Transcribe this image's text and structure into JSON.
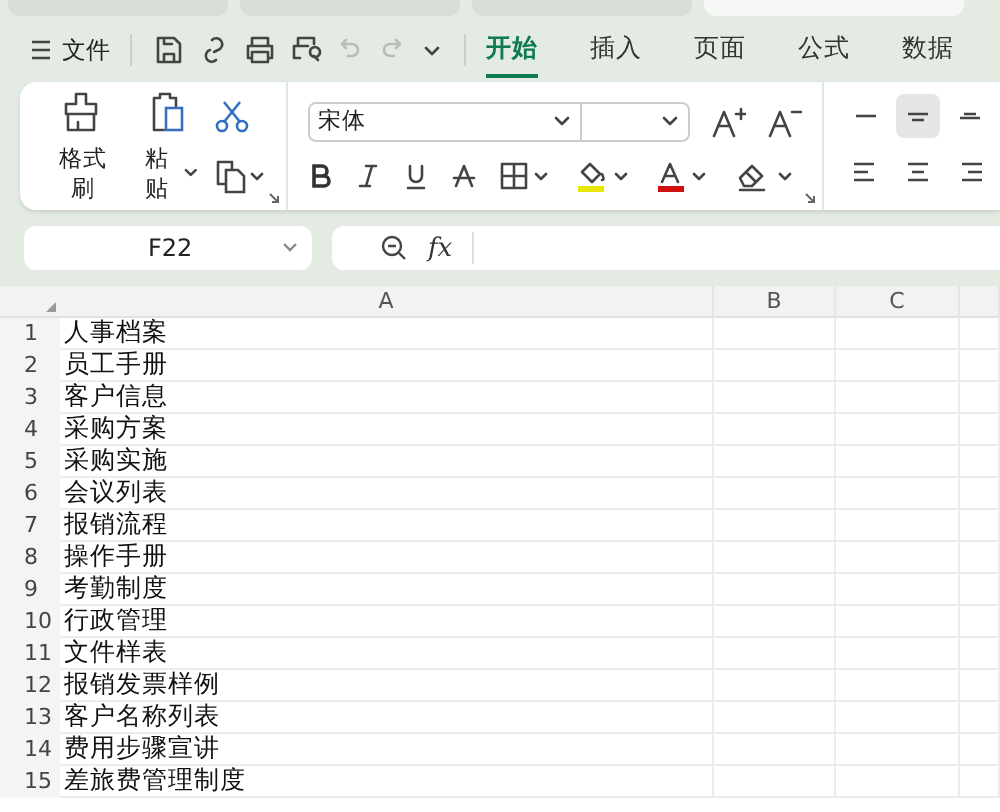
{
  "browser_tabs": [
    {
      "selected": false
    },
    {
      "selected": false
    },
    {
      "selected": false
    },
    {
      "selected": true
    }
  ],
  "menu": {
    "label": "文件"
  },
  "quick_access": [
    {
      "kind": "save",
      "disabled": false
    },
    {
      "kind": "share",
      "disabled": false
    },
    {
      "kind": "print",
      "disabled": false
    },
    {
      "kind": "preview",
      "disabled": false
    },
    {
      "kind": "undo",
      "disabled": true
    },
    {
      "kind": "redo",
      "disabled": true
    },
    {
      "kind": "more",
      "disabled": false
    }
  ],
  "tabs": [
    {
      "label": "开始",
      "selected": true
    },
    {
      "label": "插入",
      "selected": false
    },
    {
      "label": "页面",
      "selected": false
    },
    {
      "label": "公式",
      "selected": false
    },
    {
      "label": "数据",
      "selected": false
    }
  ],
  "ribbon": {
    "clipboard": [
      {
        "label": "格式刷",
        "caret": false
      },
      {
        "label": "粘贴",
        "caret": true
      }
    ],
    "font_name": "宋体",
    "align": [
      {
        "kind": "top",
        "selected": false
      },
      {
        "kind": "middle",
        "selected": true
      },
      {
        "kind": "bottom",
        "selected": false
      },
      {
        "kind": "left",
        "selected": false
      },
      {
        "kind": "center",
        "selected": false
      },
      {
        "kind": "right",
        "selected": false
      }
    ]
  },
  "name_box": "F22",
  "formula_label": "fx",
  "sheet": {
    "columns": [
      "A",
      "B",
      "C"
    ],
    "rows": [
      {
        "number": "1",
        "cells": [
          "人事档案"
        ]
      },
      {
        "number": "2",
        "cells": [
          "员工手册"
        ]
      },
      {
        "number": "3",
        "cells": [
          "客户信息"
        ]
      },
      {
        "number": "4",
        "cells": [
          "采购方案"
        ]
      },
      {
        "number": "5",
        "cells": [
          "采购实施"
        ]
      },
      {
        "number": "6",
        "cells": [
          "会议列表"
        ]
      },
      {
        "number": "7",
        "cells": [
          "报销流程"
        ]
      },
      {
        "number": "8",
        "cells": [
          "操作手册"
        ]
      },
      {
        "number": "9",
        "cells": [
          "考勤制度"
        ]
      },
      {
        "number": "10",
        "cells": [
          "行政管理"
        ]
      },
      {
        "number": "11",
        "cells": [
          "文件样表"
        ]
      },
      {
        "number": "12",
        "cells": [
          "报销发票样例"
        ]
      },
      {
        "number": "13",
        "cells": [
          "客户名称列表"
        ]
      },
      {
        "number": "14",
        "cells": [
          "费用步骤宣讲"
        ]
      },
      {
        "number": "15",
        "cells": [
          "差旅费管理制度"
        ]
      }
    ]
  }
}
